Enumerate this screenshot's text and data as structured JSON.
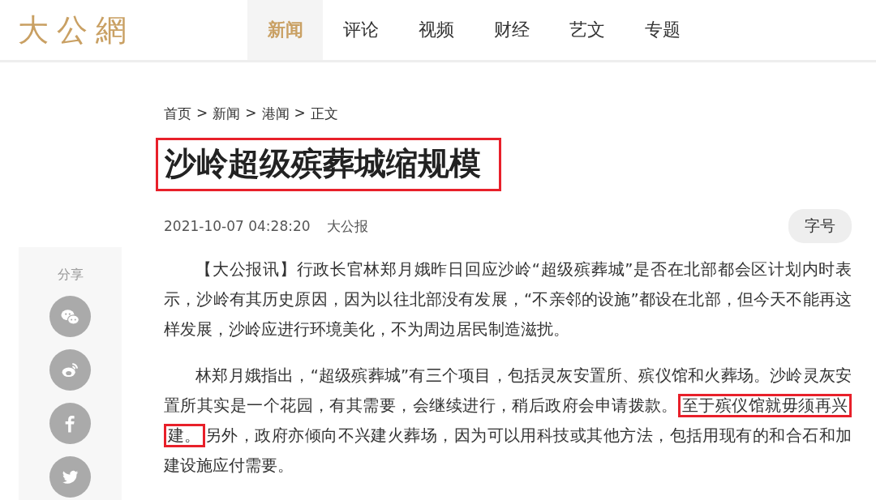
{
  "header": {
    "logo": "大公網",
    "nav": [
      {
        "label": "新闻",
        "selected": true
      },
      {
        "label": "评论",
        "selected": false
      },
      {
        "label": "视频",
        "selected": false
      },
      {
        "label": "财经",
        "selected": false
      },
      {
        "label": "艺文",
        "selected": false
      },
      {
        "label": "专题",
        "selected": false
      }
    ]
  },
  "breadcrumb": [
    "首页",
    "新闻",
    "港闻",
    "正文"
  ],
  "breadcrumb_separator": ">",
  "article": {
    "title": "沙岭超级殡葬城缩规模",
    "title_highlighted": true,
    "date": "2021-10-07 04:28:20",
    "source": "大公报",
    "font_size_button": "字号",
    "paragraphs": [
      [
        {
          "text": "【大公报讯】行政长官林郑月娥昨日回应沙岭“超级殡葬城”是否在北部都会区计划内时表示，沙岭有其历史原因，因为以往北部没有发展，“不亲邻的设施”都设在北部，但今天不能再这样发展，沙岭应进行环境美化，不为周边居民制造滋扰。",
          "highlighted": false
        }
      ],
      [
        {
          "text": "林郑月娥指出，“超级殡葬城”有三个项目，包括灵灰安置所、殡仪馆和火葬场。沙岭灵灰安置所其实是一个花园，有其需要，会继续进行，稍后政府会申请拨款。",
          "highlighted": false
        },
        {
          "text": "至于殡仪馆就毋须再兴建。",
          "highlighted": true
        },
        {
          "text": "另外，政府亦倾向不兴建火葬场，因为可以用科技或其他方法，包括用现有的和合石和加建设施应付需要。",
          "highlighted": false
        }
      ]
    ]
  },
  "share": {
    "label": "分享",
    "buttons": [
      {
        "kind": "wechat"
      },
      {
        "kind": "weibo"
      },
      {
        "kind": "facebook"
      },
      {
        "kind": "twitter"
      }
    ]
  }
}
